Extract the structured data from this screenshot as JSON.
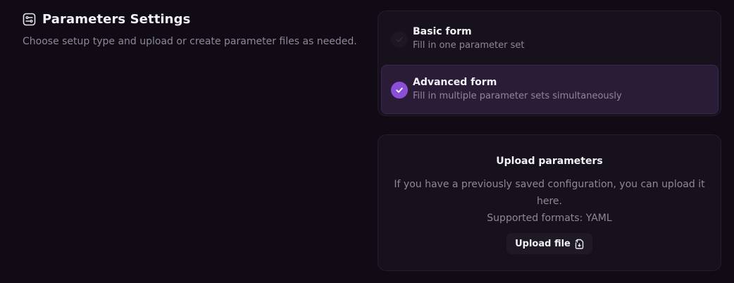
{
  "header": {
    "title": "Parameters Settings",
    "icon": "settings-sliders-icon",
    "description": "Choose setup type and upload or create parameter files as needed."
  },
  "form_options": [
    {
      "title": "Basic form",
      "subtitle": "Fill in one parameter set",
      "selected": false
    },
    {
      "title": "Advanced form",
      "subtitle": "Fill in multiple parameter sets simultaneously",
      "selected": true
    }
  ],
  "upload": {
    "title": "Upload parameters",
    "description": "If you have a previously saved configuration, you can upload it here.",
    "formats": "Supported formats: YAML",
    "button_label": "Upload file",
    "button_icon": "file-upload-icon"
  },
  "colors": {
    "background": "#100b15",
    "card": "#16111c",
    "accent": "#8b4fd6",
    "selected_bg": "#2a1b37"
  }
}
